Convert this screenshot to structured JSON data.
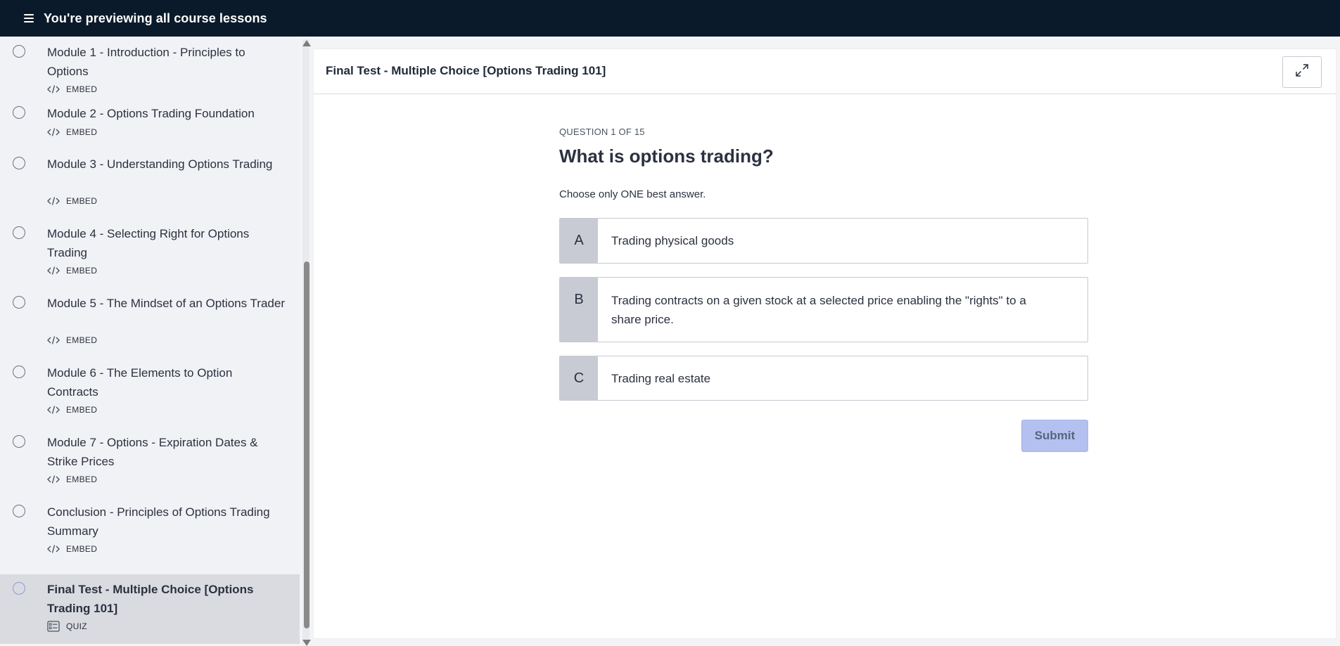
{
  "topbar": {
    "title": "You're previewing all course lessons"
  },
  "sidebar": {
    "lessons": [
      {
        "title": "Module 1 - Introduction - Principles to Options",
        "type": "EMBED",
        "icon": "embed-code-icon"
      },
      {
        "title": "Module 2 - Options Trading Foundation",
        "type": "EMBED",
        "icon": "embed-code-icon"
      },
      {
        "title": "Module 3 - Understanding Options Trading",
        "type": "EMBED",
        "icon": "embed-code-icon"
      },
      {
        "title": "Module 4 - Selecting Right for Options Trading",
        "type": "EMBED",
        "icon": "embed-code-icon"
      },
      {
        "title": "Module 5 - The Mindset of an Options Trader",
        "type": "EMBED",
        "icon": "embed-code-icon"
      },
      {
        "title": "Module 6 - The Elements to Option Contracts",
        "type": "EMBED",
        "icon": "embed-code-icon"
      },
      {
        "title": "Module 7 - Options - Expiration Dates & Strike Prices",
        "type": "EMBED",
        "icon": "embed-code-icon"
      },
      {
        "title": "Conclusion - Principles of Options Trading Summary",
        "type": "EMBED",
        "icon": "embed-code-icon"
      },
      {
        "title": "Final Test - Multiple Choice [Options Trading 101]",
        "type": "QUIZ",
        "icon": "quiz-list-icon",
        "active": true
      }
    ]
  },
  "content": {
    "title": "Final Test - Multiple Choice [Options Trading 101]",
    "expand_icon": "expand-icon"
  },
  "quiz": {
    "counter": "QUESTION 1 OF 15",
    "question": "What is options trading?",
    "instruction": "Choose only ONE best answer.",
    "options": [
      {
        "letter": "A",
        "text": "Trading physical goods"
      },
      {
        "letter": "B",
        "text": "Trading contracts on a given stock at a selected price enabling the \"rights\" to a share price."
      },
      {
        "letter": "C",
        "text": "Trading real estate"
      }
    ],
    "submit_label": "Submit"
  },
  "colors": {
    "topbar_bg": "#0b1a2b",
    "sidebar_bg": "#f1f2f5",
    "active_lesson_bg": "#d9dbe0",
    "option_letter_bg": "#c9cbd4",
    "submit_bg": "#b4c0ef"
  }
}
